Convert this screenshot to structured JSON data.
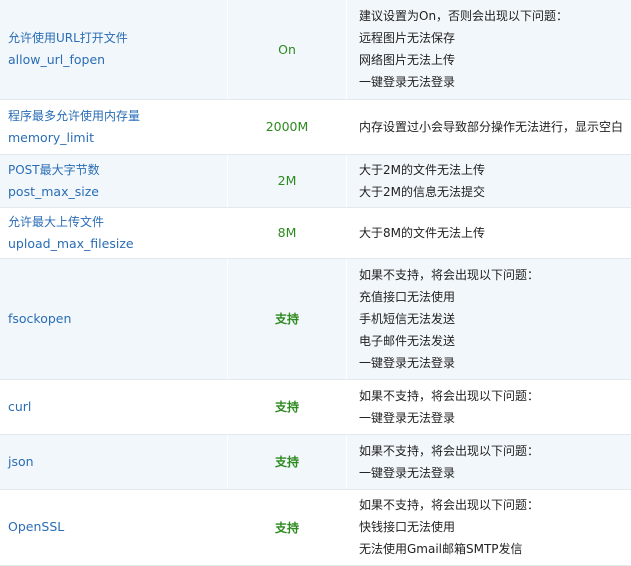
{
  "rows": [
    {
      "label": "允许使用URL打开文件",
      "key": "allow_url_fopen",
      "value": "On",
      "notes": [
        "建议设置为On，否则会出现以下问题：",
        "远程图片无法保存",
        "网络图片无法上传",
        "一键登录无法登录"
      ]
    },
    {
      "label": "程序最多允许使用内存量",
      "key": "memory_limit",
      "value": "2000M",
      "notes": [
        "内存设置过小会导致部分操作无法进行，显示空白"
      ]
    },
    {
      "label": "POST最大字节数",
      "key": "post_max_size",
      "value": "2M",
      "notes": [
        "大于2M的文件无法上传",
        "大于2M的信息无法提交"
      ]
    },
    {
      "label": "允许最大上传文件",
      "key": "upload_max_filesize",
      "value": "8M",
      "notes": [
        "大于8M的文件无法上传"
      ]
    },
    {
      "label": "",
      "key": "fsockopen",
      "value": "支持",
      "notes": [
        "如果不支持，将会出现以下问题：",
        "充值接口无法使用",
        "手机短信无法发送",
        "电子邮件无法发送",
        "一键登录无法登录"
      ]
    },
    {
      "label": "",
      "key": "curl",
      "value": "支持",
      "notes": [
        "如果不支持，将会出现以下问题：",
        "一键登录无法登录"
      ]
    },
    {
      "label": "",
      "key": "json",
      "value": "支持",
      "notes": [
        "如果不支持，将会出现以下问题：",
        "一键登录无法登录"
      ]
    },
    {
      "label": "",
      "key": "OpenSSL",
      "value": "支持",
      "notes": [
        "如果不支持，将会出现以下问题：",
        "快钱接口无法使用",
        "无法使用Gmail邮箱SMTP发信"
      ]
    }
  ]
}
